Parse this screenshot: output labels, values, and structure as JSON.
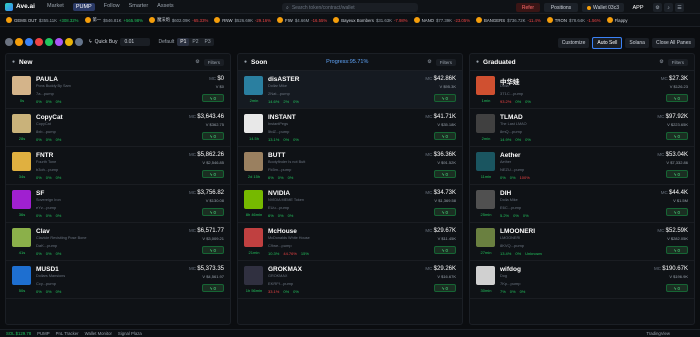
{
  "app": {
    "name": "Ave.ai"
  },
  "nav": [
    "Market",
    "PUMP",
    "Follow",
    "Smarter",
    "Assets"
  ],
  "search": {
    "placeholder": "Search token/contract/wallet"
  },
  "header": {
    "refer": "Refer",
    "positions": "Positions",
    "wallet": "Wallet 03c3",
    "app": "APP"
  },
  "ticker": [
    {
      "name": "GEMS OUT",
      "price": "$355.11K",
      "pct": "+308.32%",
      "dir": "up"
    },
    {
      "name": "第一",
      "price": "$546.81K",
      "pct": "+565.98%",
      "dir": "up"
    },
    {
      "name": "魔法炮",
      "price": "$602.09K",
      "pct": "-65.33%",
      "dir": "down"
    },
    {
      "name": "RNW",
      "price": "$526.69K",
      "pct": "-29.16%",
      "dir": "down"
    },
    {
      "name": "FIW",
      "price": "$4.66M",
      "pct": "-16.55%",
      "dir": "down"
    },
    {
      "name": "Bayeux Bombers",
      "price": "$31.63K",
      "pct": "-7.98%",
      "dir": "down"
    },
    {
      "name": "NANO",
      "price": "$77.39K",
      "pct": "-23.05%",
      "dir": "down"
    },
    {
      "name": "BANGERS",
      "price": "$736.72K",
      "pct": "-11.4%",
      "dir": "down"
    },
    {
      "name": "TRON",
      "price": "$78.64K",
      "pct": "-1.56%",
      "dir": "down"
    },
    {
      "name": "Flappy",
      "price": "",
      "pct": "",
      "dir": "up"
    }
  ],
  "toolbar": {
    "quick_buy": "Quick Buy",
    "qb_value": "0.01",
    "default": "Default",
    "presets": [
      "P1",
      "P2",
      "P3"
    ],
    "customize": "Customize",
    "auto_sell": "Auto Sell",
    "chain": "Solana",
    "close_all": "Close All Panes"
  },
  "columns": [
    {
      "title": "New",
      "mid": "",
      "filters": "Filters",
      "rows": [
        {
          "name": "PAULA",
          "sub": "Pons Buddy By Sam",
          "addr": "7a...pump",
          "age": "0s",
          "mc": "$0",
          "vol": "$0",
          "p1": "0%",
          "p2": "0%",
          "p3": "0%",
          "color": "#d4b48a"
        },
        {
          "name": "CopyCat",
          "sub": "CopyCat",
          "addr": "8xb...pump",
          "age": "28s",
          "mc": "$3,643.46",
          "vol": "$362.75",
          "p1": "0%",
          "p2": "0%",
          "p3": "0%",
          "color": "#c9b27a"
        },
        {
          "name": "FNTR",
          "sub": "Fourth Tone",
          "addr": "b3oh...pump",
          "age": "34s",
          "mc": "$5,862.26",
          "vol": "$2,546.85",
          "p1": "0%",
          "p2": "0%",
          "p3": "0%",
          "color": "#e0b040"
        },
        {
          "name": "SF",
          "sub": "Sovereign Iron",
          "addr": "eYz...pump",
          "age": "36s",
          "mc": "$3,756.82",
          "vol": "$130.08",
          "p1": "0%",
          "p2": "0%",
          "p3": "0%",
          "color": "#a020d0"
        },
        {
          "name": "Clav",
          "sub": "Clavicle Revisiting Pose Bone",
          "addr": "DaK...pump",
          "age": "41s",
          "mc": "$6,571.77",
          "vol": "$3,009.21",
          "p1": "0%",
          "p2": "0%",
          "p3": "0%",
          "color": "#8bb04a"
        },
        {
          "name": "MUSD1",
          "sub": "Dollars Mansions",
          "addr": "Ccy...pump",
          "age": "50s",
          "mc": "$5,373.35",
          "vol": "$4,561.97",
          "p1": "0%",
          "p2": "0%",
          "p3": "0%",
          "color": "#1e6fd0"
        }
      ]
    },
    {
      "title": "Soon",
      "mid": "Progress:95.71%",
      "filters": "Filters",
      "rows": [
        {
          "name": "disASTER",
          "sub": "Dollar Mike",
          "addr": "2Nat...pump",
          "age": "2min",
          "mc": "$42.86K",
          "vol": "$95.3K",
          "p1": "14.6%",
          "p2": "2%",
          "p3": "0%",
          "color": "#2a7fa0"
        },
        {
          "name": "INSTANT",
          "sub": "InstantPegs",
          "addr": "5tdZ...pump",
          "age": "14.5h",
          "mc": "$41.71K",
          "vol": "$35.18K",
          "p1": "13.1%",
          "p2": "0%",
          "p3": "0%",
          "color": "#e8e8e8"
        },
        {
          "name": "BUTT",
          "sub": "Bootyfinder Is not Butt",
          "addr": "Fk5m...pump",
          "age": "2d 15h",
          "mc": "$36.36K",
          "vol": "$91.52K",
          "p1": "6%",
          "p2": "0%",
          "p3": "0%",
          "color": "#9a8060"
        },
        {
          "name": "NVIDIA",
          "sub": "NVIDIA MEME Token",
          "addr": "EUu...pump",
          "age": "8h 46min",
          "mc": "$34.73K",
          "vol": "$1,369.58",
          "p1": "6%",
          "p2": "0%",
          "p3": "0%",
          "color": "#76b900"
        },
        {
          "name": "McHouse",
          "sub": "McDonalds White House",
          "addr": "C9we...pump",
          "age": "21min",
          "mc": "$29.67K",
          "vol": "$11.45K",
          "p1": "10.3%",
          "p2": "44.76%",
          "p3": "15%",
          "color": "#c04040"
        },
        {
          "name": "GROKMAX",
          "sub": "GROKMAX",
          "addr": "EKRFf...pump",
          "age": "1h 56min",
          "mc": "$29.26K",
          "vol": "$16.67K",
          "p1": "33.1%",
          "p2": "0%",
          "p3": "0%",
          "color": "#303040"
        }
      ]
    },
    {
      "title": "Graduated",
      "mid": "",
      "filters": "Filters",
      "rows": [
        {
          "name": "中华娃",
          "sub": "Dolla",
          "addr": "3T1C...pump",
          "age": "1min",
          "mc": "$27.3K",
          "vol": "$126.23",
          "p1": "93.2%",
          "p2": "0%",
          "p3": "0%",
          "color": "#d05030"
        },
        {
          "name": "TLMAD",
          "sub": "The Last LMAO",
          "addr": "8mQ...pump",
          "age": "2min",
          "mc": "$97.92K",
          "vol": "$223.65K",
          "p1": "14.9%",
          "p2": "0%",
          "p3": "0%",
          "color": "#404040"
        },
        {
          "name": "Aether",
          "sub": "Aether",
          "addr": "NEZU...pump",
          "age": "11min",
          "mc": "$53.04K",
          "vol": "$7,332.86",
          "p1": "0%",
          "p2": "0%",
          "p3": "100%",
          "color": "#1a5560"
        },
        {
          "name": "DIH",
          "sub": "Dolla Mike",
          "addr": "E6C...pump",
          "age": "25min",
          "mc": "$44.4K",
          "vol": "$1.5M",
          "p1": "5.2%",
          "p2": "0%",
          "p3": "0%",
          "color": "#505050"
        },
        {
          "name": "LMOONERI",
          "sub": "LMOONERI",
          "addr": "8KVQ...pump",
          "age": "27min",
          "mc": "$52.59K",
          "vol": "$282.05K",
          "p1": "13.4%",
          "p2": "0%",
          "p3": "Unknown",
          "color": "#6a8040"
        },
        {
          "name": "wifdog",
          "sub": "Dog",
          "addr": "7Kp...pump",
          "age": "30min",
          "mc": "$190.67K",
          "vol": "$196.9K",
          "p1": "7%",
          "p2": "0%",
          "p3": "0%",
          "color": "#d0d0d0"
        }
      ]
    }
  ],
  "statusbar": {
    "sol": "SOL $129.78",
    "items": [
      "PUMP",
      "PnL Tracker",
      "Wallet Monitor",
      "Signal Plaza"
    ],
    "right": "TradingView"
  },
  "labels": {
    "mc": "MC",
    "vol": "V",
    "buy": "0"
  }
}
